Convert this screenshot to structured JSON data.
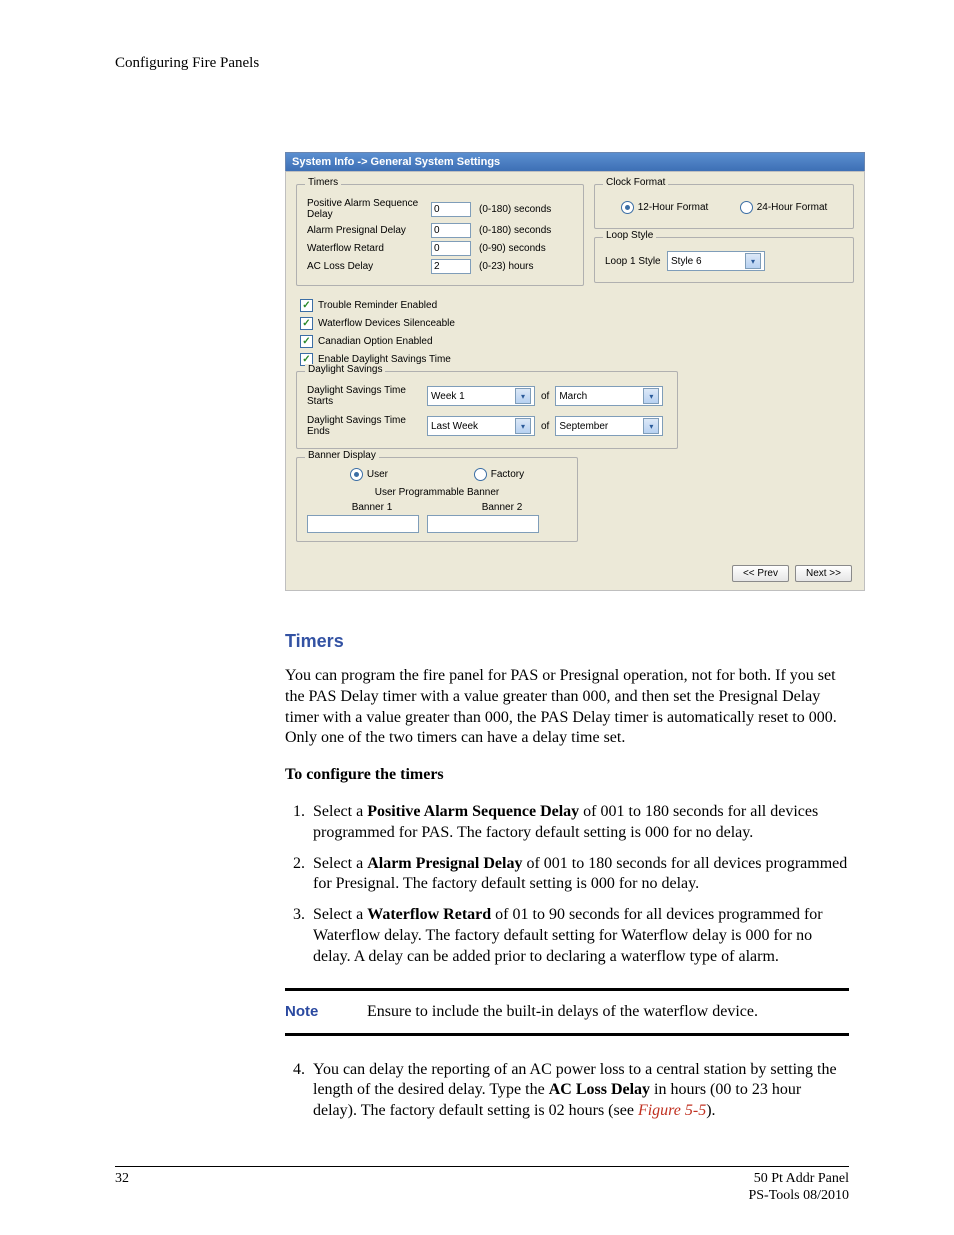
{
  "running_head": "Configuring Fire Panels",
  "screenshot": {
    "titlebar": "System Info -> General System Settings",
    "timers_legend": "Timers",
    "timers": [
      {
        "label": "Positive Alarm Sequence Delay",
        "value": "0",
        "hint": "(0-180) seconds"
      },
      {
        "label": "Alarm Presignal Delay",
        "value": "0",
        "hint": "(0-180) seconds"
      },
      {
        "label": "Waterflow Retard",
        "value": "0",
        "hint": "(0-90) seconds"
      },
      {
        "label": "AC Loss Delay",
        "value": "2",
        "hint": "(0-23) hours"
      }
    ],
    "clock_legend": "Clock Format",
    "clock_12": "12-Hour Format",
    "clock_24": "24-Hour Format",
    "loop_legend": "Loop Style",
    "loop_label": "Loop 1 Style",
    "loop_value": "Style 6",
    "checks": [
      "Trouble Reminder Enabled",
      "Waterflow Devices Silenceable",
      "Canadian Option Enabled",
      "Enable Daylight Savings Time"
    ],
    "ds_legend": "Daylight Savings",
    "ds_start_label": "Daylight Savings Time Starts",
    "ds_start_week": "Week 1",
    "ds_of": "of",
    "ds_start_month": "March",
    "ds_end_label": "Daylight Savings Time Ends",
    "ds_end_week": "Last Week",
    "ds_end_month": "September",
    "banner_legend": "Banner Display",
    "banner_user": "User",
    "banner_factory": "Factory",
    "banner_sub": "User Programmable Banner",
    "banner1": "Banner 1",
    "banner2": "Banner 2",
    "prev": "<< Prev",
    "next": "Next >>"
  },
  "section_title": "Timers",
  "intro": "You can program the fire panel for PAS or Presignal operation, not for both. If you set the PAS Delay timer with a value greater than 000, and then set the Presignal Delay timer with a value greater than 000, the PAS Delay timer is automatically reset to 000. Only one of the two timers can have a delay time set.",
  "subhead": "To configure the timers",
  "steps": {
    "s1a": "Select a ",
    "s1b": "Positive Alarm Sequence Delay",
    "s1c": " of 001 to 180 seconds for all devices programmed for PAS. The factory default setting is 000 for no delay.",
    "s2a": "Select a ",
    "s2b": "Alarm Presignal Delay",
    "s2c": " of 001 to 180 seconds for all devices programmed for Presignal. The factory default setting is 000 for no delay.",
    "s3a": "Select a ",
    "s3b": "Waterflow Retard",
    "s3c": " of 01 to 90 seconds for all devices programmed for Waterflow delay. The factory default setting for Waterflow delay is 000 for no delay. A delay can be added prior to declaring a waterflow type of alarm.",
    "s4a": "You can delay the reporting of an AC power loss to a central station by setting the length of the desired delay. Type the ",
    "s4b": "AC Loss Delay",
    "s4c": " in hours (00 to 23 hour delay). The factory default setting is 02 hours (see ",
    "s4ref": "Figure 5-5",
    "s4d": ")."
  },
  "note_label": "Note",
  "note_text": "Ensure to include the built-in delays of the waterflow device.",
  "footer": {
    "page": "32",
    "line1": "50 Pt Addr Panel",
    "line2": "PS-Tools 08/2010"
  }
}
